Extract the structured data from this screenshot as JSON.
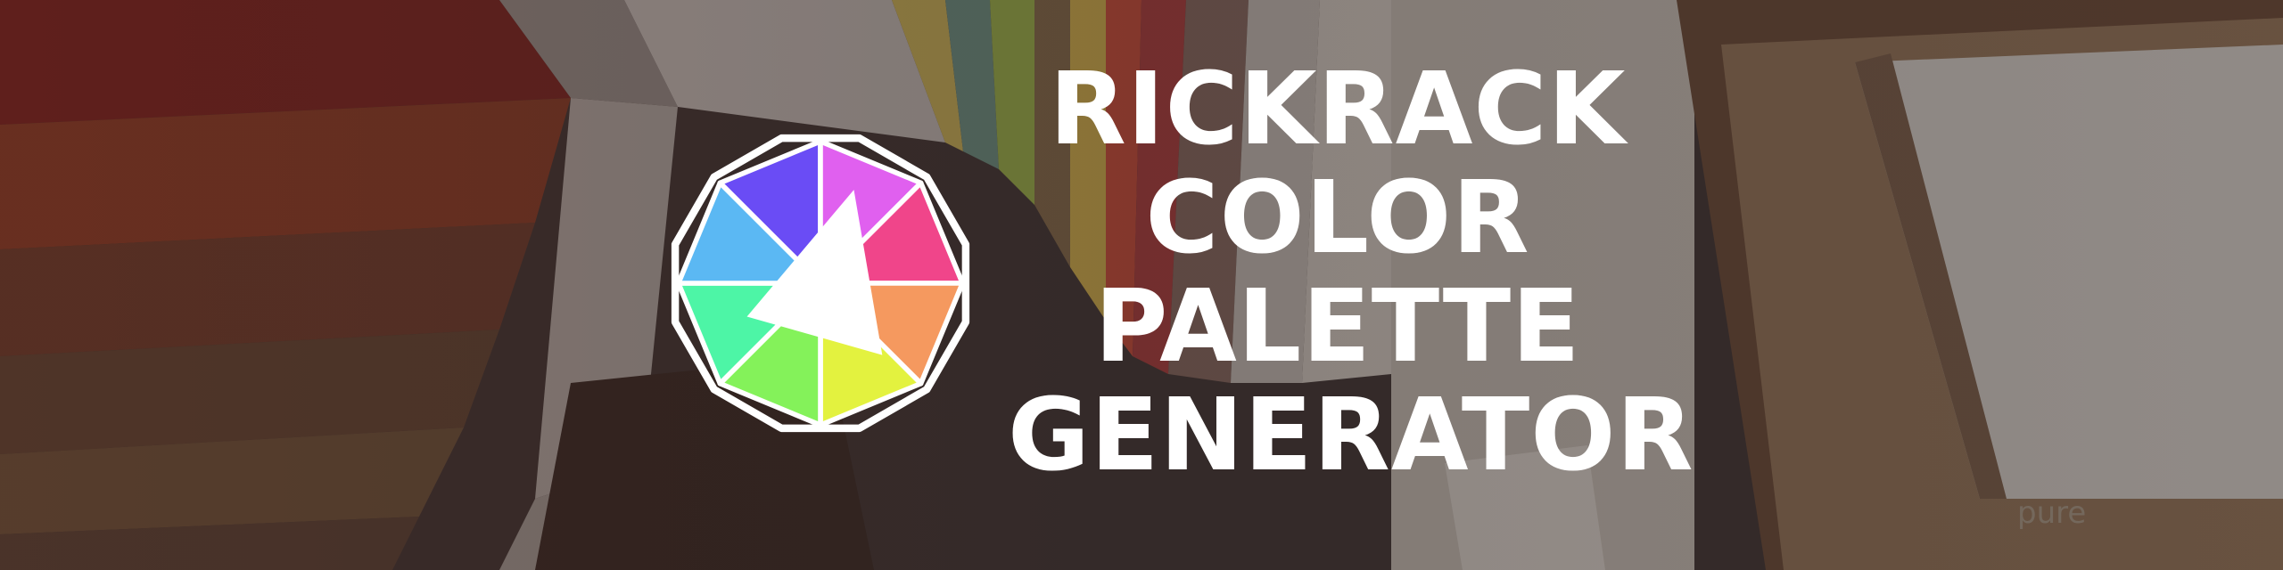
{
  "banner": {
    "title_lines": [
      "RICKRACK",
      "COLOR",
      "PALETTE",
      "GENERATOR"
    ]
  },
  "logo": {
    "name": "color-wheel-logo-icon",
    "segment_colors": [
      "#6a4cf5",
      "#e060ef",
      "#f0458a",
      "#f5995f",
      "#e3f23f",
      "#84f25a",
      "#4df5a6",
      "#5bb8f3"
    ],
    "pointer_color": "#ffffff"
  },
  "background": {
    "overlay_color": "#3a2624",
    "swatch_text": "pure"
  },
  "colors": {
    "text": "#ffffff"
  }
}
